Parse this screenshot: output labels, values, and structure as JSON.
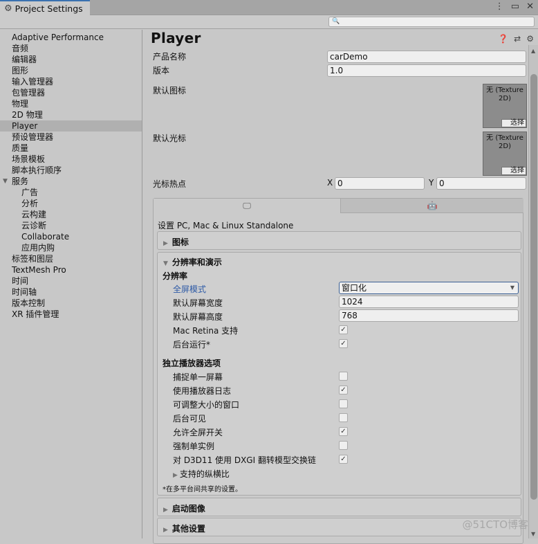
{
  "window": {
    "tab_title": "Project Settings",
    "tab_icon": "gear-icon",
    "controls": [
      "more-icon",
      "maximize-icon",
      "close-icon"
    ]
  },
  "search": {
    "placeholder": ""
  },
  "sidebar": {
    "items": [
      {
        "label": "Adaptive Performance"
      },
      {
        "label": "音频"
      },
      {
        "label": "编辑器"
      },
      {
        "label": "图形"
      },
      {
        "label": "输入管理器"
      },
      {
        "label": "包管理器"
      },
      {
        "label": "物理"
      },
      {
        "label": "2D 物理"
      },
      {
        "label": "Player",
        "selected": true
      },
      {
        "label": "预设管理器"
      },
      {
        "label": "质量"
      },
      {
        "label": "场景模板"
      },
      {
        "label": "脚本执行顺序"
      },
      {
        "label": "服务",
        "expanded": true
      },
      {
        "label": "广告",
        "sub": true
      },
      {
        "label": "分析",
        "sub": true
      },
      {
        "label": "云构建",
        "sub": true
      },
      {
        "label": "云诊断",
        "sub": true
      },
      {
        "label": "Collaborate",
        "sub": true
      },
      {
        "label": "应用内购",
        "sub": true
      },
      {
        "label": "标签和图层"
      },
      {
        "label": "TextMesh Pro"
      },
      {
        "label": "时间"
      },
      {
        "label": "时间轴"
      },
      {
        "label": "版本控制"
      },
      {
        "label": "XR 插件管理"
      }
    ]
  },
  "main": {
    "title": "Player",
    "header_icons": [
      "help-icon",
      "presets-icon",
      "settings-icon"
    ],
    "product_name_label": "产品名称",
    "product_name_value": "carDemo",
    "version_label": "版本",
    "version_value": "1.0",
    "default_icon_label": "默认图标",
    "default_cursor_label": "默认光标",
    "texture_none": "无 (Texture 2D)",
    "texture_select": "选择",
    "cursor_hotspot_label": "光标热点",
    "hotspot_x_label": "X",
    "hotspot_x_value": "0",
    "hotspot_y_label": "Y",
    "hotspot_y_value": "0",
    "platform_tabs": [
      "desktop-icon",
      "android-icon"
    ],
    "platform_title": "设置 PC, Mac & Linux Standalone",
    "sections": {
      "icon": "图标",
      "resolution": "分辨率和演示",
      "splash": "启动图像",
      "other": "其他设置"
    },
    "resolution": {
      "subheader": "分辨率",
      "fullscreen_mode_label": "全屏模式",
      "fullscreen_mode_value": "窗口化",
      "default_width_label": "默认屏幕宽度",
      "default_width_value": "1024",
      "default_height_label": "默认屏幕高度",
      "default_height_value": "768",
      "mac_retina_label": "Mac Retina 支持",
      "mac_retina_checked": true,
      "run_in_background_label": "后台运行*",
      "run_in_background_checked": true
    },
    "standalone": {
      "subheader": "独立播放器选项",
      "options": [
        {
          "label": "捕捉单一屏幕",
          "checked": false
        },
        {
          "label": "使用播放器日志",
          "checked": true
        },
        {
          "label": "可调整大小的窗口",
          "checked": false
        },
        {
          "label": "后台可见",
          "checked": false
        },
        {
          "label": "允许全屏开关",
          "checked": true
        },
        {
          "label": "强制单实例",
          "checked": false
        },
        {
          "label": "对 D3D11 使用 DXGI 翻转模型交换链",
          "checked": true
        }
      ],
      "aspect_ratios": "支持的纵横比",
      "footnote": "*在多平台间共享的设置。"
    }
  },
  "watermark": "@51CTO博客"
}
